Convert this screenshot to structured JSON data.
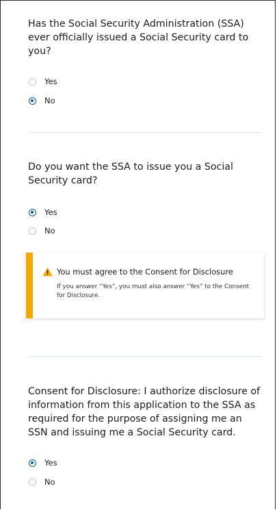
{
  "questions": [
    {
      "text": "Has the Social Security Administration (SSA) ever officially issued a Social Security card to you?",
      "options": [
        {
          "label": "Yes",
          "selected": false
        },
        {
          "label": "No",
          "selected": true
        }
      ]
    },
    {
      "text": "Do you want the SSA to issue you a Social Security card?",
      "options": [
        {
          "label": "Yes",
          "selected": true
        },
        {
          "label": "No",
          "selected": false
        }
      ]
    },
    {
      "text": "Consent for Disclosure: I authorize disclosure of information from this application to the SSA as required for the purpose of assigning me an SSN and issuing me a Social Security card.",
      "options": [
        {
          "label": "Yes",
          "selected": true
        },
        {
          "label": "No",
          "selected": false
        }
      ]
    }
  ],
  "alert": {
    "title": "You must agree to the Consent for Disclosure",
    "body": "If you answer “Yes”, you must also answer “Yes” to the Consent for Disclosure.",
    "icon": "warning-icon"
  },
  "colors": {
    "accent": "#005ea2",
    "warning": "#f5a800",
    "divider": "#cfe3f2"
  }
}
